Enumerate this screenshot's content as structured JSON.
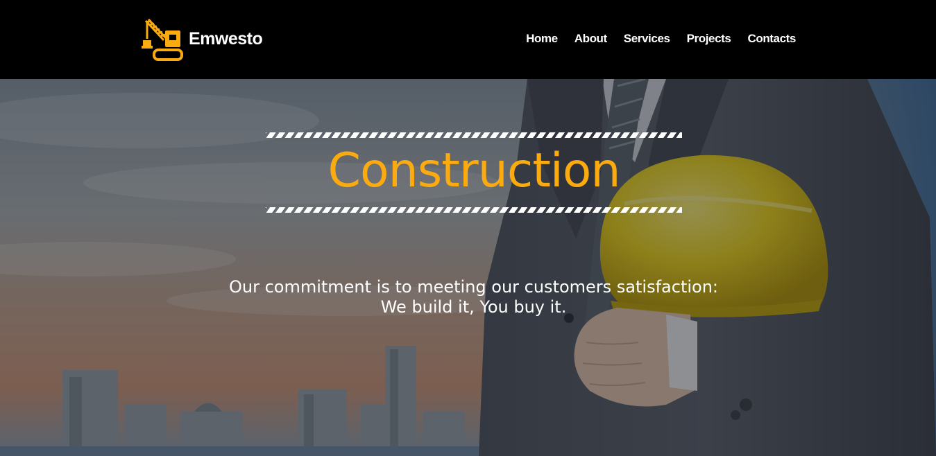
{
  "brand": {
    "name": "Emwesto",
    "logo_icon": "crane-icon",
    "logo_color": "#fbab10"
  },
  "nav": {
    "items": [
      {
        "label": "Home"
      },
      {
        "label": "About"
      },
      {
        "label": "Services"
      },
      {
        "label": "Projects"
      },
      {
        "label": "Contacts"
      }
    ]
  },
  "hero": {
    "title": "Construction",
    "title_color": "#fbab10",
    "tagline_line1": "Our commitment is to meeting our customers satisfaction:",
    "tagline_line2": "We build it, You buy it.",
    "background": "businessman-holding-hard-hat-city-skyline"
  }
}
